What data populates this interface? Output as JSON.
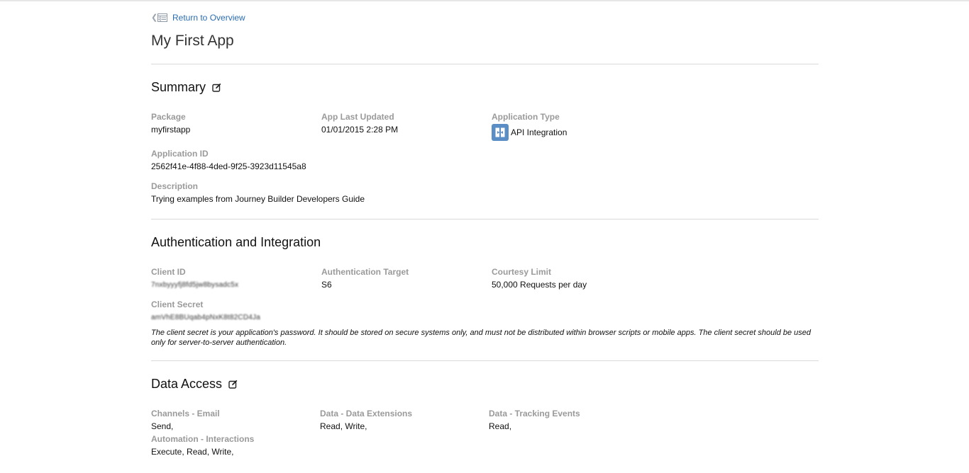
{
  "nav": {
    "back_label": "Return to Overview"
  },
  "app": {
    "title": "My First App"
  },
  "summary": {
    "heading": "Summary",
    "package_label": "Package",
    "package_value": "myfirstapp",
    "updated_label": "App Last Updated",
    "updated_value": "01/01/2015 2:28 PM",
    "type_label": "Application Type",
    "type_value": "API Integration",
    "app_id_label": "Application ID",
    "app_id_value": "2562f41e-4f88-4ded-9f25-3923d11545a8",
    "description_label": "Description",
    "description_value": "Trying examples from Journey Builder Developers Guide"
  },
  "auth": {
    "heading": "Authentication and Integration",
    "client_id_label": "Client ID",
    "client_id_value": "7nxbyyyfj8fd5jw8bysadc5x",
    "target_label": "Authentication Target",
    "target_value": "S6",
    "limit_label": "Courtesy Limit",
    "limit_value": "50,000 Requests per day",
    "secret_label": "Client Secret",
    "secret_value": "amVhE8BUqab4pNxK8t82CD4Ja",
    "secret_note": "The client secret is your application's password. It should be stored on secure systems only, and must not be distributed within browser scripts or mobile apps. The client secret should be used only for server-to-server authentication."
  },
  "data_access": {
    "heading": "Data Access",
    "email_label": "Channels - Email",
    "email_value": "Send,",
    "extensions_label": "Data - Data Extensions",
    "extensions_value": "Read, Write,",
    "tracking_label": "Data - Tracking Events",
    "tracking_value": "Read,",
    "interactions_label": "Automation - Interactions",
    "interactions_value": "Execute, Read, Write,"
  },
  "colors": {
    "link": "#2a6db0",
    "label": "#9a9a9a",
    "api_icon": "#5b8ec4",
    "divider": "#d9d9d9"
  },
  "icons": {
    "back": "chevron-left-icon",
    "overview": "list-icon",
    "edit": "edit-icon",
    "app_type": "api-integration-icon"
  }
}
